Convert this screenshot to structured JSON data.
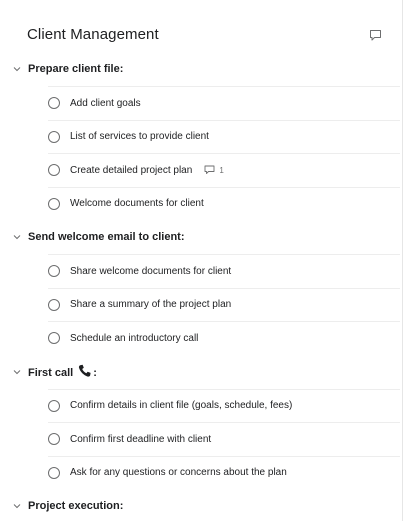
{
  "header": {
    "title": "Client Management",
    "comment_icon": "comment-bubble-icon"
  },
  "sections": [
    {
      "title": "Prepare client file:",
      "collapsed": false,
      "tasks": [
        {
          "name": "Add client goals"
        },
        {
          "name": "List of services to provide client"
        },
        {
          "name": "Create detailed project plan",
          "comments": "1"
        },
        {
          "name": "Welcome documents for client"
        }
      ]
    },
    {
      "title": "Send welcome email to client:",
      "collapsed": false,
      "tasks": [
        {
          "name": "Share welcome documents for client"
        },
        {
          "name": "Share a summary of the project plan"
        },
        {
          "name": "Schedule an introductory call"
        }
      ]
    },
    {
      "title": "First call",
      "title_suffix": ":",
      "title_icon": "phone-icon",
      "collapsed": false,
      "tasks": [
        {
          "name": "Confirm details in client file (goals, schedule, fees)"
        },
        {
          "name": "Confirm first deadline with client"
        },
        {
          "name": "Ask for any questions or concerns about the plan"
        }
      ]
    },
    {
      "title": "Project execution:",
      "collapsed": false,
      "tasks": []
    }
  ]
}
